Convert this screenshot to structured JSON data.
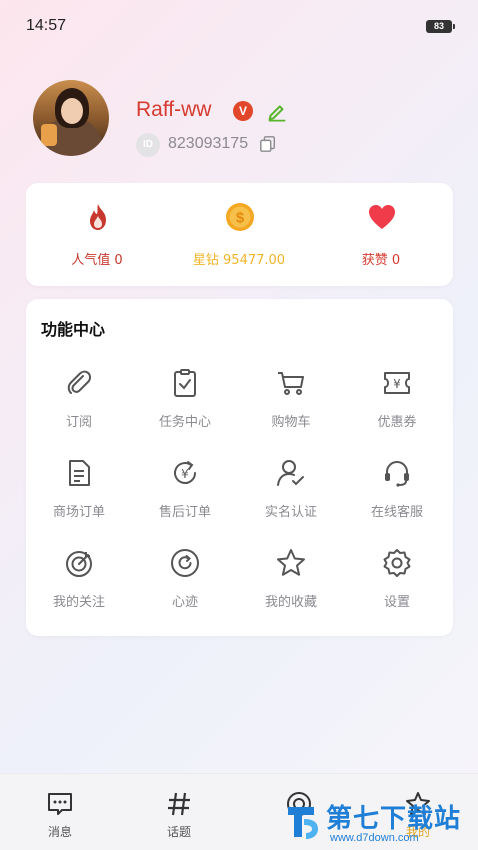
{
  "status_bar": {
    "time": "14:57",
    "battery": "83"
  },
  "profile": {
    "nickname": "Raff-ww",
    "badge": "V",
    "id_label": "ID",
    "id_number": "823093175"
  },
  "stats": [
    {
      "label": "人气值 0",
      "icon": "flame-icon",
      "color": "#c8372d"
    },
    {
      "label": "星钻 95477.00",
      "icon": "coin-icon",
      "color": "#f0b429"
    },
    {
      "label": "获赞 0",
      "icon": "heart-icon",
      "color": "#e63946"
    }
  ],
  "functions": {
    "title": "功能中心",
    "items": [
      {
        "label": "订阅",
        "icon": "paperclip-icon"
      },
      {
        "label": "任务中心",
        "icon": "clipboard-check-icon"
      },
      {
        "label": "购物车",
        "icon": "cart-icon"
      },
      {
        "label": "优惠券",
        "icon": "coupon-icon"
      },
      {
        "label": "商场订单",
        "icon": "document-icon"
      },
      {
        "label": "售后订单",
        "icon": "yen-refresh-icon"
      },
      {
        "label": "实名认证",
        "icon": "user-check-icon"
      },
      {
        "label": "在线客服",
        "icon": "headset-icon"
      },
      {
        "label": "我的关注",
        "icon": "target-icon"
      },
      {
        "label": "心迹",
        "icon": "refresh-circle-icon"
      },
      {
        "label": "我的收藏",
        "icon": "star-icon"
      },
      {
        "label": "设置",
        "icon": "gear-icon"
      }
    ]
  },
  "tabbar": {
    "items": [
      {
        "label": "消息",
        "icon": "message-icon"
      },
      {
        "label": "话题",
        "icon": "hash-icon"
      },
      {
        "label": "",
        "icon": "discover-icon"
      },
      {
        "label": "我的",
        "icon": "profile-icon"
      }
    ]
  },
  "watermark": {
    "title": "第七下载站",
    "url": "www.d7down.com"
  }
}
